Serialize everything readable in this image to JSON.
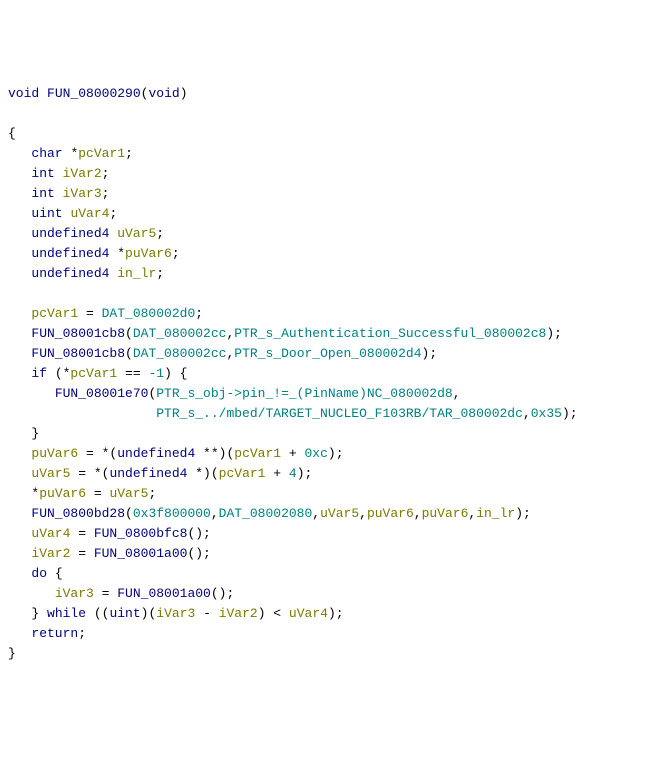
{
  "sig": {
    "ret": "void",
    "name": "FUN_08000290",
    "params": "(void)"
  },
  "decls": {
    "d1t": "char",
    "d1p": "*",
    "d1n": "pcVar1",
    "d2t": "int",
    "d2n": "iVar2",
    "d3t": "int",
    "d3n": "iVar3",
    "d4t": "uint",
    "d4n": "uVar4",
    "d5t": "undefined4",
    "d5n": "uVar5",
    "d6t": "undefined4",
    "d6p": "*",
    "d6n": "puVar6",
    "d7t": "undefined4",
    "d7n": "in_lr"
  },
  "body": {
    "l1a": "pcVar1",
    "l1b": " = ",
    "l1c": "DAT_080002d0",
    "l2f": "FUN_08001cb8",
    "l2a1": "DAT_080002cc",
    "l2a2": "PTR_s_Authentication_Successful_080002c8",
    "l3f": "FUN_08001cb8",
    "l3a1": "DAT_080002cc",
    "l3a2": "PTR_s_Door_Open_080002d4",
    "l4a": "if",
    "l4b": " (*",
    "l4c": "pcVar1",
    "l4d": " == ",
    "l4e": "-1",
    "l4f": ") {",
    "l5f": "FUN_08001e70",
    "l5a1": "PTR_s_obj->pin_!=_(PinName)NC_080002d8",
    "l6a1": "PTR_s_../mbed/TARGET_NUCLEO_F103RB/TAR_080002dc",
    "l6a2": "0x35",
    "l7": "}",
    "l8a": "puVar6",
    "l8b": " = *(",
    "l8c": "undefined4",
    "l8d": " **)(",
    "l8e": "pcVar1",
    "l8f": " + ",
    "l8g": "0xc",
    "l8h": ");",
    "l9a": "uVar5",
    "l9b": " = *(",
    "l9c": "undefined4",
    "l9d": " *)(",
    "l9e": "pcVar1",
    "l9f": " + ",
    "l9g": "4",
    "l9h": ");",
    "l10a": "*",
    "l10b": "puVar6",
    "l10c": " = ",
    "l10d": "uVar5",
    "l11f": "FUN_0800bd28",
    "l11a1": "0x3f800000",
    "l11a2": "DAT_08002080",
    "l11a3": "uVar5",
    "l11a4": "puVar6",
    "l11a5": "puVar6",
    "l11a6": "in_lr",
    "l12a": "uVar4",
    "l12b": " = ",
    "l12f": "FUN_0800bfc8",
    "l13a": "iVar2",
    "l13b": " = ",
    "l13f": "FUN_08001a00",
    "l14": "do",
    "l14b": " {",
    "l15a": "iVar3",
    "l15b": " = ",
    "l15f": "FUN_08001a00",
    "l16a": "} ",
    "l16w": "while",
    "l16b": " ((",
    "l16c": "uint",
    "l16d": ")(",
    "l16e": "iVar3",
    "l16f": " - ",
    "l16g": "iVar2",
    "l16h": ") < ",
    "l16i": "uVar4",
    "l16j": ");",
    "l17": "return",
    "l18": "}"
  }
}
